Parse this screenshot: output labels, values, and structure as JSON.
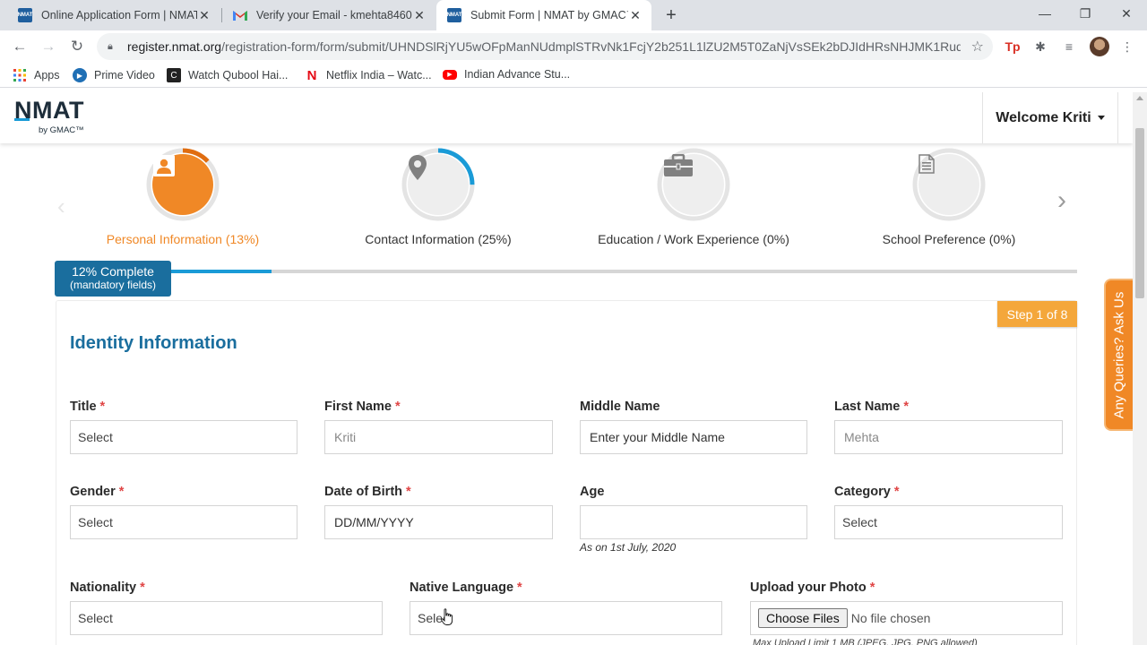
{
  "browser": {
    "tabs": [
      {
        "title": "Online Application Form | NMAT",
        "active": false
      },
      {
        "title": "Verify your Email - kmehta8460@",
        "active": false
      },
      {
        "title": "Submit Form | NMAT by GMAC™",
        "active": true
      }
    ],
    "url_host": "register.nmat.org",
    "url_path": "/registration-form/form/submit/UHNDSlRjYU5wOFpManNUdmplSTRvNk1FcjY2b251L1lZU2M5T0ZaNjVsSEk2bDJIdHRsNHJMK1Rud...",
    "bookmarks": [
      "Apps",
      "Prime Video",
      "Watch Qubool Hai...",
      "Netflix India – Watc...",
      "Indian Advance Stu..."
    ]
  },
  "header": {
    "logo_text": "NMAT",
    "logo_sub": "by GMAC™",
    "welcome": "Welcome Kriti"
  },
  "steps": [
    {
      "label": "Personal Information (13%)",
      "icon": "user-icon",
      "percent": 13
    },
    {
      "label": "Contact Information (25%)",
      "icon": "location-pin-icon",
      "percent": 25
    },
    {
      "label": "Education / Work Experience (0%)",
      "icon": "briefcase-icon",
      "percent": 0
    },
    {
      "label": "School Preference (0%)",
      "icon": "document-icon",
      "percent": 0
    }
  ],
  "progress": {
    "line1": "12% Complete",
    "line2": "(mandatory fields)",
    "percent": 12
  },
  "form": {
    "step_badge": "Step 1 of 8",
    "section_title": "Identity Information",
    "fields": {
      "title": {
        "label": "Title",
        "value": "Select"
      },
      "first_name": {
        "label": "First Name",
        "value": "Kriti"
      },
      "middle_name": {
        "label": "Middle Name",
        "placeholder": "Enter your Middle Name"
      },
      "last_name": {
        "label": "Last Name",
        "value": "Mehta"
      },
      "gender": {
        "label": "Gender",
        "value": "Select"
      },
      "dob": {
        "label": "Date of Birth",
        "placeholder": "DD/MM/YYYY"
      },
      "age": {
        "label": "Age",
        "value": "",
        "note": "As on 1st July, 2020"
      },
      "category": {
        "label": "Category",
        "value": "Select"
      },
      "nationality": {
        "label": "Nationality",
        "value": "Select"
      },
      "native_language": {
        "label": "Native Language",
        "value": "Select"
      },
      "photo": {
        "label": "Upload your Photo",
        "button": "Choose Files",
        "status": "No file chosen",
        "hint": "Max Upload Limit 1 MB (JPEG, JPG, PNG allowed)"
      }
    },
    "required_mark": "*"
  },
  "side_tab": "Any Queries? Ask Us",
  "colors": {
    "accent_orange": "#f08826",
    "accent_blue": "#1a6e9e",
    "progress_blue": "#1a9bd7",
    "required_red": "#e04545"
  }
}
